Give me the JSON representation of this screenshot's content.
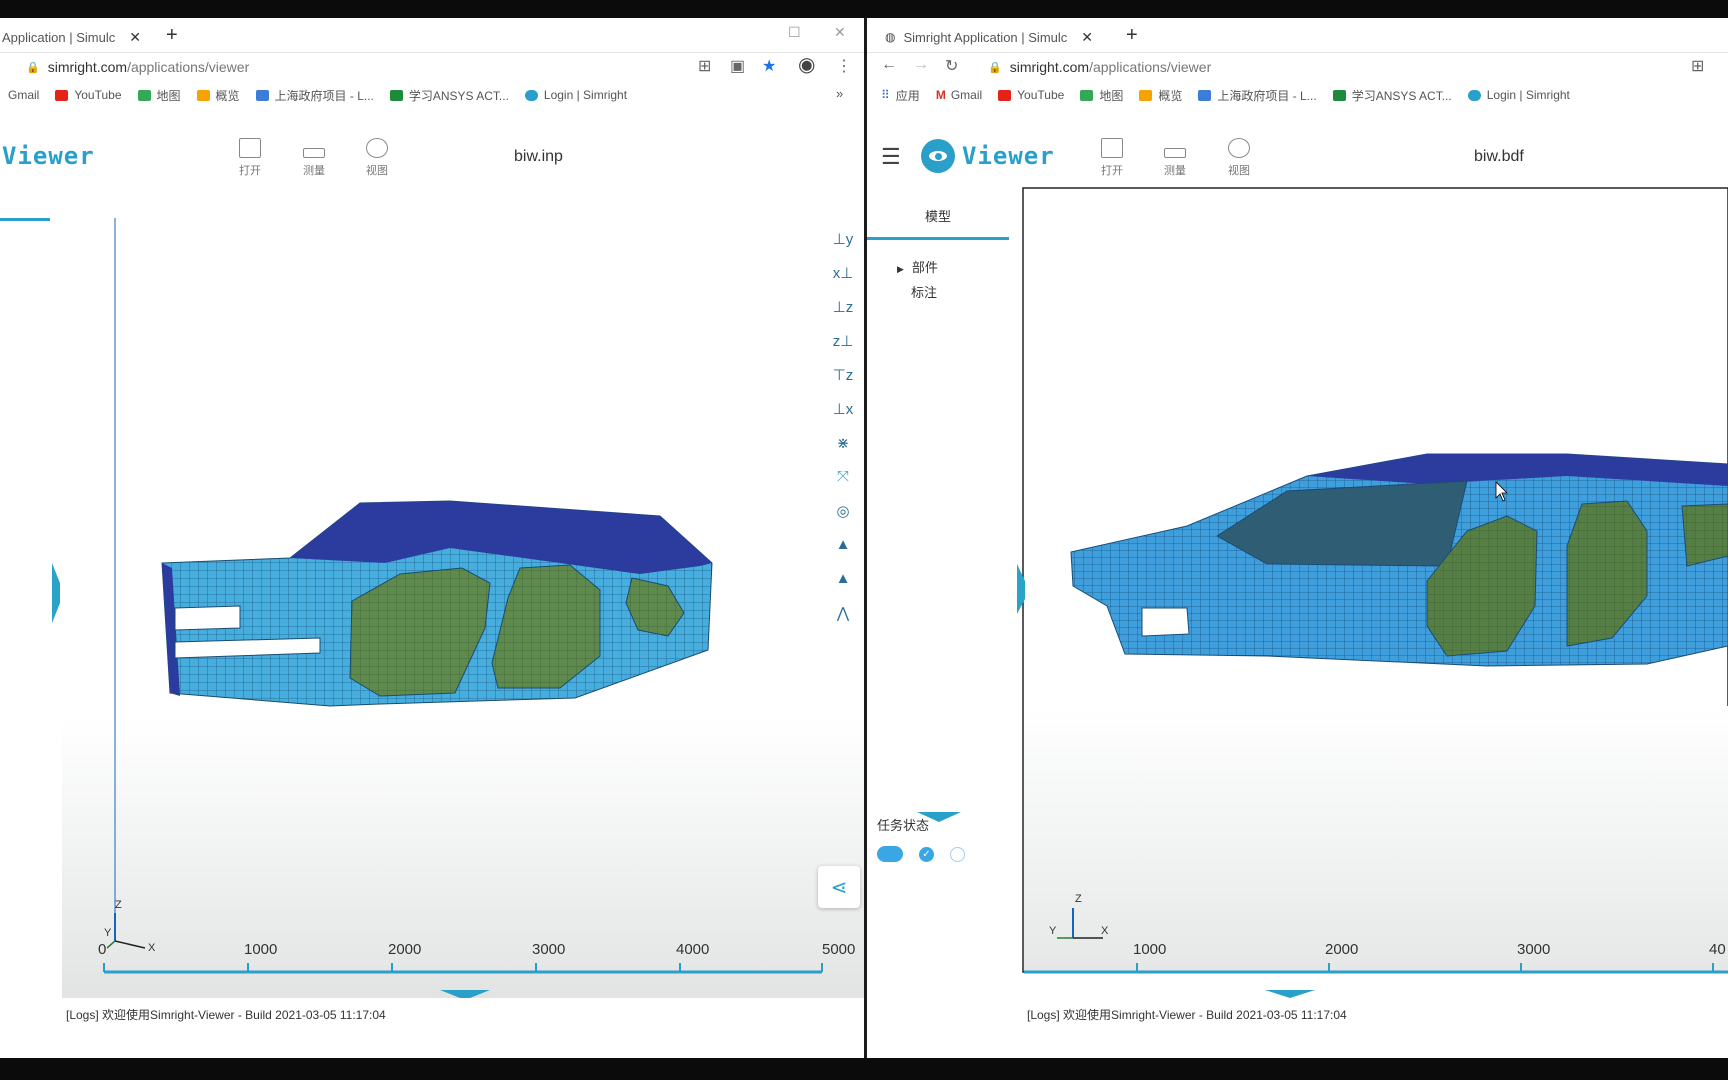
{
  "left": {
    "tab_title": "Application | Simulc",
    "url_host": "simright.com",
    "url_path": "/applications/viewer",
    "bookmarks": [
      "Gmail",
      "YouTube",
      "地图",
      "概览",
      "上海政府项目 - L...",
      "学习ANSYS ACT...",
      "Login | Simright"
    ],
    "bookmark_more": "»",
    "app_name": "Viewer",
    "tools": [
      "打开",
      "测量",
      "视图"
    ],
    "file_name": "biw.inp",
    "ruler": [
      "0",
      "1000",
      "2000",
      "3000",
      "4000",
      "5000"
    ],
    "axis_labels": {
      "z": "Z",
      "y": "Y",
      "x": "X"
    },
    "log": "[Logs] 欢迎使用Simright-Viewer - Build 2021-03-05 11:17:04"
  },
  "right": {
    "tab_title": "Simright Application | Simulc",
    "url_host": "simright.com",
    "url_path": "/applications/viewer",
    "bookmarks": [
      "应用",
      "Gmail",
      "YouTube",
      "地图",
      "概览",
      "上海政府项目 - L...",
      "学习ANSYS ACT...",
      "Login | Simright"
    ],
    "app_name": "Viewer",
    "tools": [
      "打开",
      "测量",
      "视图"
    ],
    "file_name": "biw.bdf",
    "panel_tab": "模型",
    "tree": [
      "部件",
      "标注"
    ],
    "task_label": "任务状态",
    "ruler": [
      "1000",
      "2000",
      "3000",
      "40"
    ],
    "axis_labels": {
      "z": "Z",
      "y": "Y",
      "x": "X"
    },
    "log": "[Logs] 欢迎使用Simright-Viewer - Build 2021-03-05 11:17:04"
  },
  "colors": {
    "accent": "#2a9fc9",
    "mesh": "#3aa6d8",
    "roof": "#2b3b9b",
    "window": "#5f8a4c"
  }
}
